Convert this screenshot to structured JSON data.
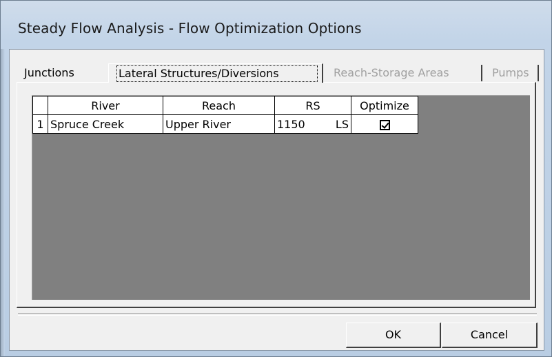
{
  "window": {
    "title": "Steady Flow Analysis - Flow Optimization Options"
  },
  "tabs": [
    {
      "label": "Junctions",
      "state": "normal"
    },
    {
      "label": "Lateral Structures/Diversions",
      "state": "selected"
    },
    {
      "label": "Reach-Storage Areas",
      "state": "disabled"
    },
    {
      "label": "Pumps",
      "state": "disabled"
    }
  ],
  "table": {
    "headers": {
      "index": "",
      "river": "River",
      "reach": "Reach",
      "rs": "RS",
      "optimize": "Optimize"
    },
    "rows": [
      {
        "index": "1",
        "river": "Spruce Creek",
        "reach": "Upper River",
        "rs_value": "1150",
        "rs_type": "LS",
        "optimize": true
      }
    ]
  },
  "buttons": {
    "ok": "OK",
    "cancel": "Cancel"
  }
}
